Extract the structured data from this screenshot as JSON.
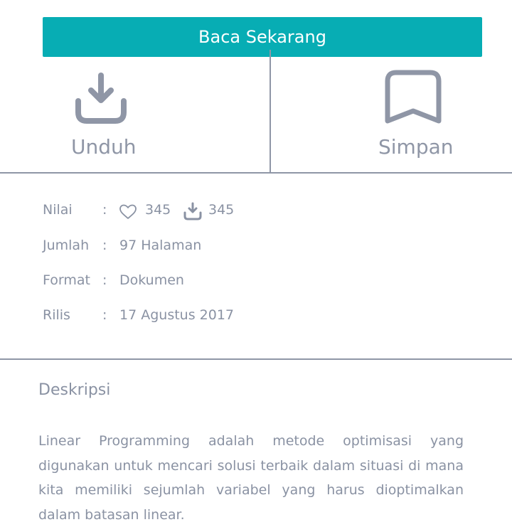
{
  "primary_action": {
    "label": "Baca Sekarang"
  },
  "actions": {
    "download": {
      "label": "Unduh",
      "icon": "download-icon"
    },
    "save": {
      "label": "Simpan",
      "icon": "bookmark-icon"
    }
  },
  "details": {
    "rating": {
      "key": "Nilai",
      "colon": ":",
      "likes": "345",
      "downloads": "345",
      "like_icon": "heart-icon",
      "download_icon": "download-icon"
    },
    "pages": {
      "key": "Jumlah",
      "colon": ":",
      "value": "97 Halaman"
    },
    "format": {
      "key": "Format",
      "colon": ":",
      "value": "Dokumen"
    },
    "release": {
      "key": "Rilis",
      "colon": ":",
      "value": "17 Agustus 2017"
    }
  },
  "description": {
    "title": "Deskripsi",
    "body": "Linear Programming adalah metode optimisasi yang digunakan untuk mencari solusi terbaik dalam situasi di mana kita memiliki sejumlah variabel yang harus dioptimalkan dalam batasan linear."
  },
  "colors": {
    "accent": "#07adb4",
    "text_muted": "#8a92a3",
    "divider": "#8f96a6",
    "background": "#ffffff"
  }
}
